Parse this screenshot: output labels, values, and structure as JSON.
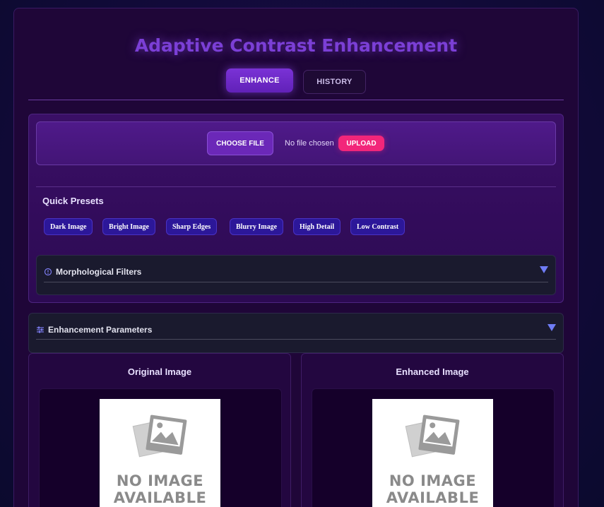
{
  "app": {
    "title": "Adaptive Contrast Enhancement"
  },
  "tabs": [
    {
      "label": "ENHANCE",
      "active": true
    },
    {
      "label": "HISTORY",
      "active": false
    }
  ],
  "upload": {
    "choose_label": "CHOOSE FILE",
    "file_status": "No file chosen",
    "upload_label": "UPLOAD"
  },
  "presets": {
    "title": "Quick Presets",
    "items": [
      "Dark Image",
      "Bright Image",
      "Sharp Edges",
      "Blurry Image",
      "High Detail",
      "Low Contrast"
    ]
  },
  "filters": {
    "title": "Morphological Filters",
    "icon": "info-circle-icon"
  },
  "params": {
    "title": "Enhancement Parameters",
    "icon": "sliders-icon"
  },
  "images": {
    "original_title": "Original Image",
    "enhanced_title": "Enhanced Image",
    "placeholder_line1": "NO IMAGE",
    "placeholder_line2": "AVAILABLE"
  },
  "colors": {
    "accent": "#7b3fd6",
    "upload_pink": "#f2267a",
    "preset_blue": "#2c1799",
    "arrow_blue": "#6f7cf5"
  }
}
